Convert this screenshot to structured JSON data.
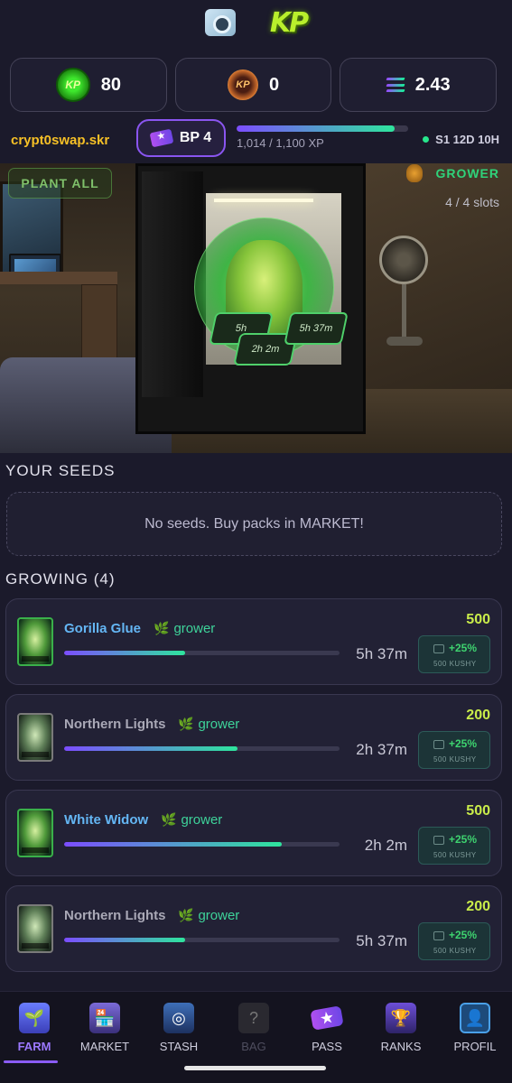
{
  "balances": [
    {
      "icon": "kp-coin-icon",
      "value": "80"
    },
    {
      "icon": "gold-coin-icon",
      "value": "0"
    },
    {
      "icon": "solana-icon",
      "value": "2.43"
    }
  ],
  "user": {
    "name": "crypt0swap.skr",
    "bp_label": "BP 4",
    "xp_text": "1,014 / 1,100 XP",
    "xp_progress": 0.922,
    "season": "S1 12D 10H"
  },
  "scene": {
    "plant_all": "PLANT ALL",
    "rank": "GROWER",
    "slots": "4 / 4 slots",
    "pots": [
      "5h",
      "2h 2m",
      "5h 37m"
    ]
  },
  "seeds": {
    "title": "YOUR SEEDS",
    "empty_text": "No seeds. Buy packs in MARKET!"
  },
  "growing": {
    "title": "GROWING (4)",
    "plants": [
      {
        "name": "Gorilla Glue",
        "tag": "grower",
        "time": "5h 37m",
        "value": "500",
        "boost": "+25%",
        "boost_sub": "500 KUSHY",
        "progress": 0.44,
        "rare": true
      },
      {
        "name": "Northern Lights",
        "tag": "grower",
        "time": "2h 37m",
        "value": "200",
        "boost": "+25%",
        "boost_sub": "500 KUSHY",
        "progress": 0.63,
        "rare": false
      },
      {
        "name": "White Widow",
        "tag": "grower",
        "time": "2h 2m",
        "value": "500",
        "boost": "+25%",
        "boost_sub": "500 KUSHY",
        "progress": 0.79,
        "rare": true
      },
      {
        "name": "Northern Lights",
        "tag": "grower",
        "time": "5h 37m",
        "value": "200",
        "boost": "+25%",
        "boost_sub": "500 KUSHY",
        "progress": 0.44,
        "rare": false
      }
    ]
  },
  "nav": [
    {
      "label": "FARM",
      "icon": "farm-icon",
      "state": "active"
    },
    {
      "label": "MARKET",
      "icon": "market-icon",
      "state": "normal"
    },
    {
      "label": "STASH",
      "icon": "stash-icon",
      "state": "normal"
    },
    {
      "label": "BAG",
      "icon": "bag-icon",
      "state": "disabled"
    },
    {
      "label": "PASS",
      "icon": "pass-icon",
      "state": "normal"
    },
    {
      "label": "RANKS",
      "icon": "ranks-icon",
      "state": "normal"
    },
    {
      "label": "PROFIL",
      "icon": "profile-icon",
      "state": "normal"
    }
  ],
  "colors": {
    "background": "#1b1a2b",
    "username": "#f6c026",
    "accent_purple": "#8b5cf6",
    "accent_green": "#2ee59d",
    "value_yellow": "#c9ec4a",
    "rare_name": "#64b6f4"
  }
}
